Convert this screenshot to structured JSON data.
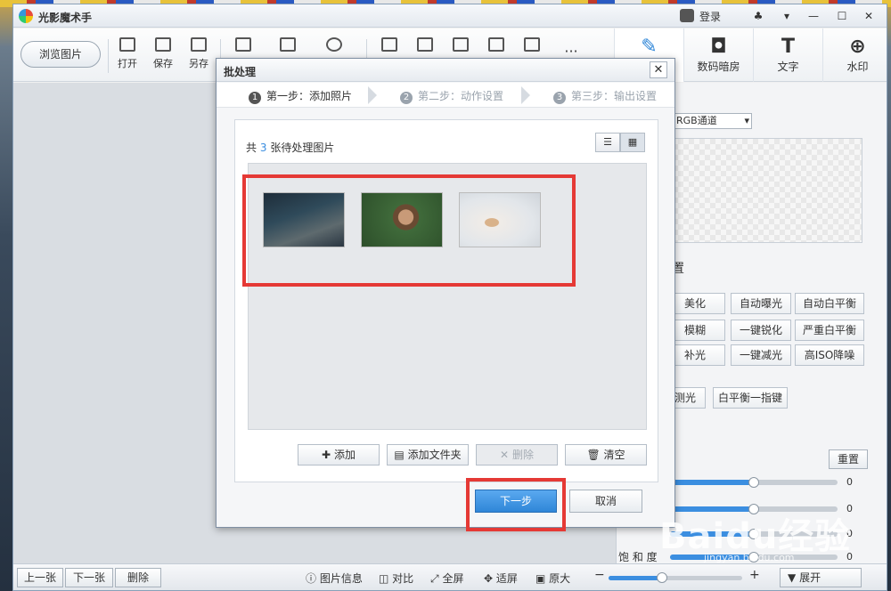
{
  "app": {
    "title": "光影魔术手",
    "login": "登录"
  },
  "window_controls": {
    "skin": "♣",
    "menu": "▾",
    "minimize": "—",
    "maximize": "☐",
    "close": "✕"
  },
  "toolbar": {
    "browse": "浏览图片",
    "open": "打开",
    "save": "保存",
    "saveas": "另存",
    "right_tabs": [
      {
        "label": "",
        "icon": "✎"
      },
      {
        "label": "数码暗房",
        "icon": "◘"
      },
      {
        "label": "文字",
        "icon": "T"
      },
      {
        "label": "水印",
        "icon": "⊕"
      }
    ]
  },
  "right_panel": {
    "channel": "RGB通道",
    "section_title": "置",
    "effects": [
      "美化",
      "自动曝光",
      "自动白平衡",
      "模糊",
      "一键锐化",
      "严重白平衡",
      "补光",
      "一键减光",
      "高ISO降噪",
      "测光",
      "白平衡一指键"
    ],
    "reset": "重置",
    "sliders": [
      {
        "label": "",
        "value": "0",
        "level": 0.5
      },
      {
        "label": "",
        "value": "0",
        "level": 0.5
      },
      {
        "label": "",
        "value": "0",
        "level": 0.5
      },
      {
        "label": "饱 和 度",
        "value": "0",
        "level": 0.5
      },
      {
        "label": "",
        "value": "0",
        "level": 0.5
      }
    ]
  },
  "bottom": {
    "prev": "上一张",
    "next": "下一张",
    "delete": "删除",
    "info": "图片信息",
    "compare": "对比",
    "fullscreen": "全屏",
    "fit": "适屏",
    "original": "原大",
    "zoom_minus": "−",
    "zoom_plus": "+",
    "expand": "展开",
    "zoom_level": 0.4
  },
  "dialog": {
    "title": "批处理",
    "close": "✕",
    "steps": [
      {
        "num": "1",
        "label": "第一步：添加照片"
      },
      {
        "num": "2",
        "label": "第二步：动作设置"
      },
      {
        "num": "3",
        "label": "第三步：输出设置"
      }
    ],
    "count_prefix": "共",
    "count": "3",
    "count_suffix": "张待处理图片",
    "view_list": "☰",
    "view_grid": "▦",
    "buttons": {
      "add": "添加",
      "add_folder": "添加文件夹",
      "remove": "删除",
      "clear": "清空"
    },
    "next": "下一步",
    "cancel": "取消"
  },
  "watermark": {
    "text": "Baidu经验",
    "url": "jingyan.baidu.com"
  }
}
